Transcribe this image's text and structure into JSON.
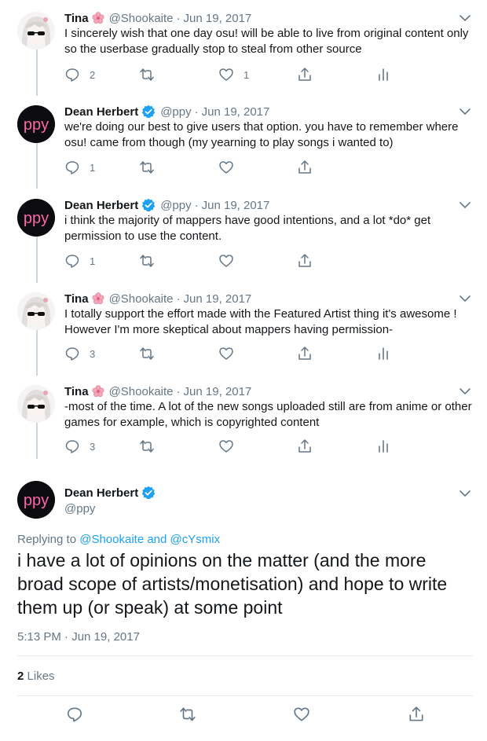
{
  "tweets": [
    {
      "name": "Tina",
      "handle": "@Shookaite",
      "date": "Jun 19, 2017",
      "text": "I sincerely wish that one day osu! will be able to live from original content only so the userbase gradually stop to steal from other source",
      "replies": "2",
      "retweets": "",
      "likes": "1"
    },
    {
      "name": "Dean Herbert",
      "handle": "@ppy",
      "date": "Jun 19, 2017",
      "text": "we're doing our best to give users that option. you have to remember where osu! came from though (my yearning to play songs i wanted to)",
      "replies": "1",
      "retweets": "",
      "likes": ""
    },
    {
      "name": "Dean Herbert",
      "handle": "@ppy",
      "date": "Jun 19, 2017",
      "text": "i think the majority of mappers have good intentions, and a lot *do* get permission to use the content.",
      "replies": "1",
      "retweets": "",
      "likes": ""
    },
    {
      "name": "Tina",
      "handle": "@Shookaite",
      "date": "Jun 19, 2017",
      "text": "I totally support the effort made with the Featured Artist thing it's awesome ! However I'm more skeptical about mappers having permission-",
      "replies": "3",
      "retweets": "",
      "likes": ""
    },
    {
      "name": "Tina",
      "handle": "@Shookaite",
      "date": "Jun 19, 2017",
      "text": "-most of the time. A lot of the new songs uploaded still are from anime or other games for example, which is copyrighted content",
      "replies": "3",
      "retweets": "",
      "likes": ""
    }
  ],
  "dot": "·",
  "main": {
    "name": "Dean Herbert",
    "handle": "@ppy",
    "replying_prefix": "Replying to",
    "reply_user1": "@Shookaite",
    "reply_and": "and",
    "reply_user2": "@cYsmix",
    "text": "i have a lot of opinions on the matter (and the more broad scope of artists/monetisation) and hope to write them up (or speak) at some point",
    "timestamp": "5:13 PM · Jun 19, 2017",
    "likes_count": "2",
    "likes_label": "Likes"
  },
  "avatar_ppy_text": "ppy",
  "colors": {
    "link": "#1da1f2",
    "muted": "#657786",
    "thread_line": "#ccd6dd",
    "verified": "#1da1f2",
    "ppy_pink": "#ff66aa"
  }
}
